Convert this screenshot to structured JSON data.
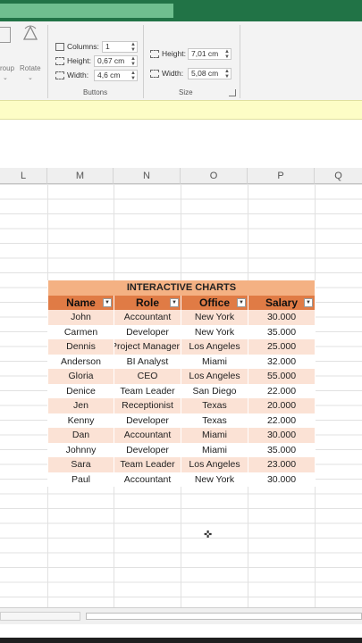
{
  "ribbon": {
    "group_label_partial": "roup",
    "rotate_label": "Rotate",
    "columns_label": "Columns:",
    "columns_value": "1",
    "height_label": "Height:",
    "button_height_value": "0,67 cm",
    "width_label": "Width:",
    "button_width_value": "4,6 cm",
    "buttons_group": "Buttons",
    "size_height_label": "Height:",
    "size_height_value": "7,01 cm",
    "size_width_label": "Width:",
    "size_width_value": "5,08 cm",
    "size_group": "Size"
  },
  "columns": [
    "L",
    "M",
    "N",
    "O",
    "P",
    "Q"
  ],
  "table": {
    "title": "INTERACTIVE CHARTS",
    "headers": [
      "Name",
      "Role",
      "Office",
      "Salary"
    ],
    "rows": [
      [
        "John",
        "Accountant",
        "New York",
        "30.000"
      ],
      [
        "Carmen",
        "Developer",
        "New York",
        "35.000"
      ],
      [
        "Dennis",
        "Project Manager",
        "Los Angeles",
        "25.000"
      ],
      [
        "Anderson",
        "BI Analyst",
        "Miami",
        "32.000"
      ],
      [
        "Gloria",
        "CEO",
        "Los Angeles",
        "55.000"
      ],
      [
        "Denice",
        "Team Leader",
        "San Diego",
        "22.000"
      ],
      [
        "Jen",
        "Receptionist",
        "Texas",
        "20.000"
      ],
      [
        "Kenny",
        "Developer",
        "Texas",
        "22.000"
      ],
      [
        "Dan",
        "Accountant",
        "Miami",
        "30.000"
      ],
      [
        "Johnny",
        "Developer",
        "Miami",
        "35.000"
      ],
      [
        "Sara",
        "Team Leader",
        "Los Angeles",
        "23.000"
      ],
      [
        "Paul",
        "Accountant",
        "New York",
        "30.000"
      ]
    ]
  },
  "colors": {
    "title_fill": "#f4b183",
    "header_fill": "#e07b45",
    "band_fill": "#fbe2d5",
    "excel_green": "#217346"
  }
}
